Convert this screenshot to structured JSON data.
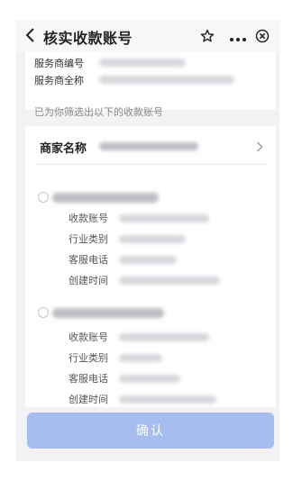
{
  "header": {
    "title": "核实收款账号"
  },
  "top_info": {
    "provider_id_label": "服务商编号",
    "provider_name_label": "服务商全称"
  },
  "hint": "已为你筛选出以下的收款账号",
  "merchant": {
    "label": "商家名称"
  },
  "accounts": [
    {
      "fields": [
        "收款账号",
        "行业类别",
        "客服电话",
        "创建时间"
      ]
    },
    {
      "fields": [
        "收款账号",
        "行业类别",
        "客服电话",
        "创建时间"
      ]
    }
  ],
  "actions": {
    "confirm": "确认"
  },
  "icons": {
    "back": "back-arrow-icon",
    "star": "star-icon",
    "more": "more-icon",
    "close": "close-circle-icon",
    "chevron": "chevron-right-icon"
  }
}
